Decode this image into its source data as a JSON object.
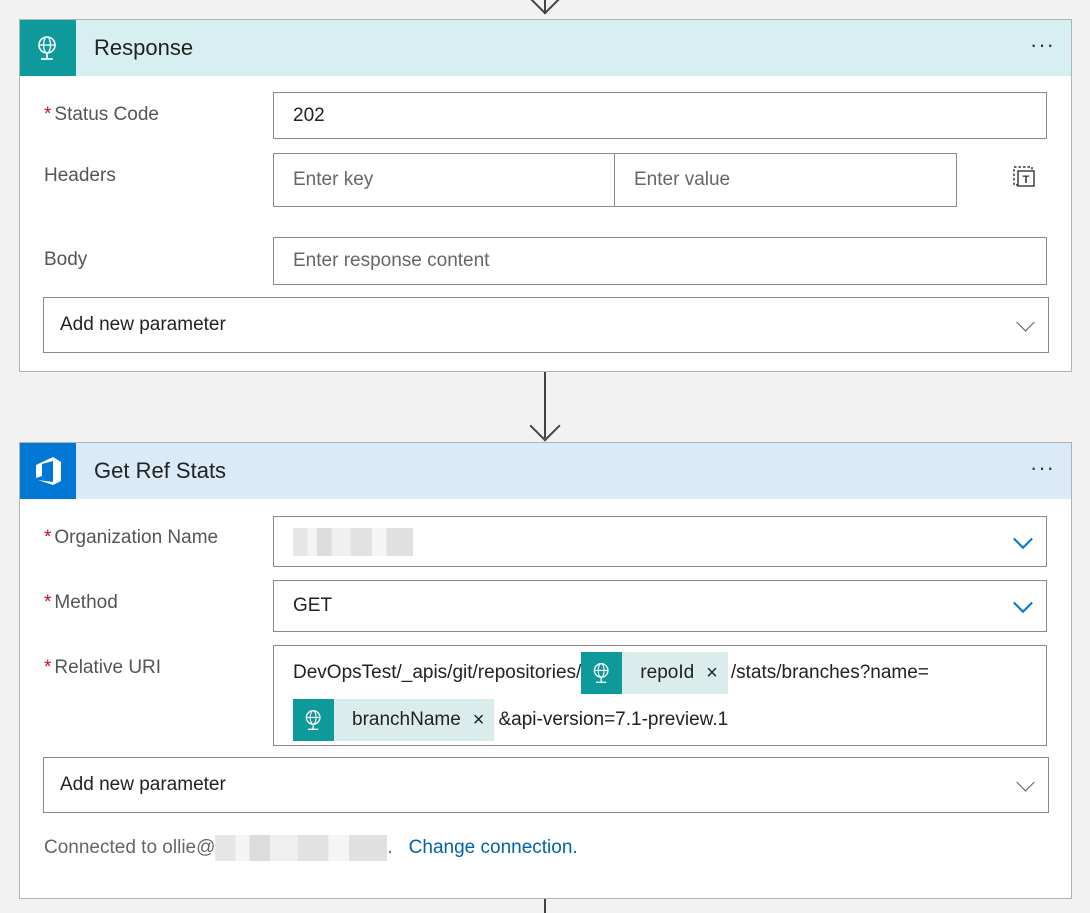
{
  "response_card": {
    "title": "Response",
    "more_label": "···",
    "icon": "globe-icon",
    "header_color": "#d7eff0",
    "icon_bg": "#0e9a9a",
    "status_code": {
      "required": "*",
      "label": "Status Code",
      "value": "202"
    },
    "headers": {
      "label": "Headers",
      "key_placeholder": "Enter key",
      "value_placeholder": "Enter value",
      "toggle_icon": "text-mode-icon"
    },
    "body": {
      "label": "Body",
      "placeholder": "Enter response content"
    },
    "add_param": {
      "label": "Add new parameter"
    }
  },
  "refstats_card": {
    "title": "Get Ref Stats",
    "more_label": "···",
    "icon": "azure-devops-icon",
    "header_color": "#daeaf7",
    "icon_bg": "#0078d4",
    "organization": {
      "required": "*",
      "label": "Organization Name"
    },
    "method": {
      "required": "*",
      "label": "Method",
      "value": "GET"
    },
    "relative_uri": {
      "required": "*",
      "label": "Relative URI",
      "text1": "DevOpsTest/_apis/git/repositories/",
      "token1": "repoId",
      "text2": "/stats/branches?name=",
      "token2": "branchName",
      "text3": "&api-version=7.1-preview.1",
      "remove_label": "×"
    },
    "add_param": {
      "label": "Add new parameter"
    },
    "connection": {
      "prefix": "Connected to ollie@",
      "dot": ".",
      "change_link": "Change connection."
    }
  }
}
